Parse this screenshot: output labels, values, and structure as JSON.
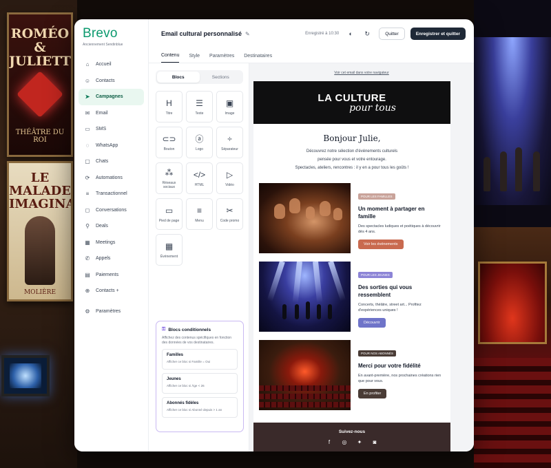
{
  "backdrop": {
    "poster1": {
      "title": "ROMÉO & JULIETTE",
      "footer": "THÉÂTRE DU ROI"
    },
    "poster2": {
      "title": "LE MALADE IMAGINAIRE",
      "subtitle": "MOLIÈRE"
    }
  },
  "sidebar": {
    "logo": "Brevo",
    "tagline": "Anciennement Sendinblue",
    "items": [
      {
        "label": "Accueil",
        "icon": "home-icon",
        "glyph": "⌂"
      },
      {
        "label": "Contacts",
        "icon": "contacts-icon",
        "glyph": "☺"
      },
      {
        "label": "Campagnes",
        "icon": "send-icon",
        "glyph": "➤",
        "active": true
      },
      {
        "label": "Email",
        "icon": "mail-icon",
        "glyph": "✉"
      },
      {
        "label": "SMS",
        "icon": "sms-icon",
        "glyph": "▭"
      },
      {
        "label": "WhatsApp",
        "icon": "whatsapp-icon",
        "glyph": "◌"
      },
      {
        "label": "Chats",
        "icon": "chat-icon",
        "glyph": "▢"
      },
      {
        "label": "Automations",
        "icon": "automation-icon",
        "glyph": "⟳"
      },
      {
        "label": "Transactionnel",
        "icon": "transactional-icon",
        "glyph": "≡"
      },
      {
        "label": "Conversations",
        "icon": "conversations-icon",
        "glyph": "◻"
      },
      {
        "label": "Deals",
        "icon": "deals-icon",
        "glyph": "⚲"
      },
      {
        "label": "Meetings",
        "icon": "calendar-icon",
        "glyph": "▦"
      },
      {
        "label": "Appels",
        "icon": "phone-icon",
        "glyph": "✆"
      },
      {
        "label": "Paiements",
        "icon": "payment-icon",
        "glyph": "▤"
      },
      {
        "label": "Contacts +",
        "icon": "contacts-plus-icon",
        "glyph": "⊕"
      },
      {
        "label": "Paramètres",
        "icon": "settings-icon",
        "glyph": "⚙"
      }
    ]
  },
  "topbar": {
    "title": "Email cultural personnalisé",
    "saved": "Enregistré à 10:30",
    "quit_label": "Quitter",
    "save_quit_label": "Enregistrer et quitter"
  },
  "tabs": [
    "Contenu",
    "Style",
    "Paramètres",
    "Destinataires"
  ],
  "panel": {
    "segments": [
      "Blocs",
      "Sections"
    ],
    "blocks": [
      {
        "label": "Titre",
        "glyph": "H",
        "icon": "heading-icon"
      },
      {
        "label": "Texte",
        "glyph": "☰",
        "icon": "text-icon"
      },
      {
        "label": "Image",
        "glyph": "▣",
        "icon": "image-icon"
      },
      {
        "label": "Bouton",
        "glyph": "⊂⊃",
        "icon": "button-icon"
      },
      {
        "label": "Logo",
        "glyph": "ⓐ",
        "icon": "logo-icon"
      },
      {
        "label": "Séparateur",
        "glyph": "÷",
        "icon": "divider-icon"
      },
      {
        "label": "Réseaux sociaux",
        "glyph": "⁂",
        "icon": "social-icon"
      },
      {
        "label": "HTML",
        "glyph": "</>",
        "icon": "code-icon"
      },
      {
        "label": "Vidéo",
        "glyph": "▷",
        "icon": "video-icon"
      },
      {
        "label": "Pied de page",
        "glyph": "▭",
        "icon": "footer-icon"
      },
      {
        "label": "Menu",
        "glyph": "≡",
        "icon": "menu-icon"
      },
      {
        "label": "Code promo",
        "glyph": "✂",
        "icon": "promo-icon"
      },
      {
        "label": "Événement",
        "glyph": "▦",
        "icon": "event-icon"
      }
    ],
    "conditional": {
      "title": "Blocs conditionnels",
      "desc": "Affichez des contenus spécifiques en fonction des données de vos destinataires.",
      "rules": [
        {
          "title": "Familles",
          "detail": "Afficher ce bloc si Famille = Oui"
        },
        {
          "title": "Jeunes",
          "detail": "Afficher ce bloc si Âge < 26"
        },
        {
          "title": "Abonnés fidèles",
          "detail": "Afficher ce bloc si Abonné depuis > 1 an"
        }
      ]
    }
  },
  "email": {
    "browser_link": "Voir cet email dans votre navigateur",
    "hero_line1": "LA CULTURE",
    "hero_line2": "pour tous",
    "greeting": "Bonjour Julie,",
    "intro1": "Découvrez notre sélection d'événements culturels",
    "intro2": "pensée pour vous et votre entourage.",
    "intro3": "Spectacles, ateliers, rencontres : il y en a pour tous les goûts !",
    "cards": [
      {
        "badge": "POUR LES FAMILLES",
        "badge_color": "#c9a39a",
        "title": "Un moment à partager en famille",
        "desc": "Des spectacles ludiques et poétiques à découvrir dès 4 ans.",
        "cta": "Voir les événements",
        "cta_color": "#c96a4f"
      },
      {
        "badge": "POUR LES JEUNES",
        "badge_color": "#8c84d6",
        "title": "Des sorties qui vous ressemblent",
        "desc": "Concerts, théâtre, street art... Profitez d'expériences uniques !",
        "cta": "Découvrir",
        "cta_color": "#6f74c9"
      },
      {
        "badge": "POUR NOS ABONNÉS",
        "badge_color": "#4a3c36",
        "title": "Merci pour votre fidélité",
        "desc": "En avant-première, nos prochaines créations rien que pour vous.",
        "cta": "En profiter",
        "cta_color": "#4a3c36"
      }
    ],
    "footer_title": "Suivez-nous",
    "socials": [
      {
        "icon": "facebook-icon",
        "glyph": "f"
      },
      {
        "icon": "instagram-icon",
        "glyph": "◎"
      },
      {
        "icon": "twitter-icon",
        "glyph": "✦"
      },
      {
        "icon": "discord-icon",
        "glyph": "◙"
      }
    ]
  }
}
